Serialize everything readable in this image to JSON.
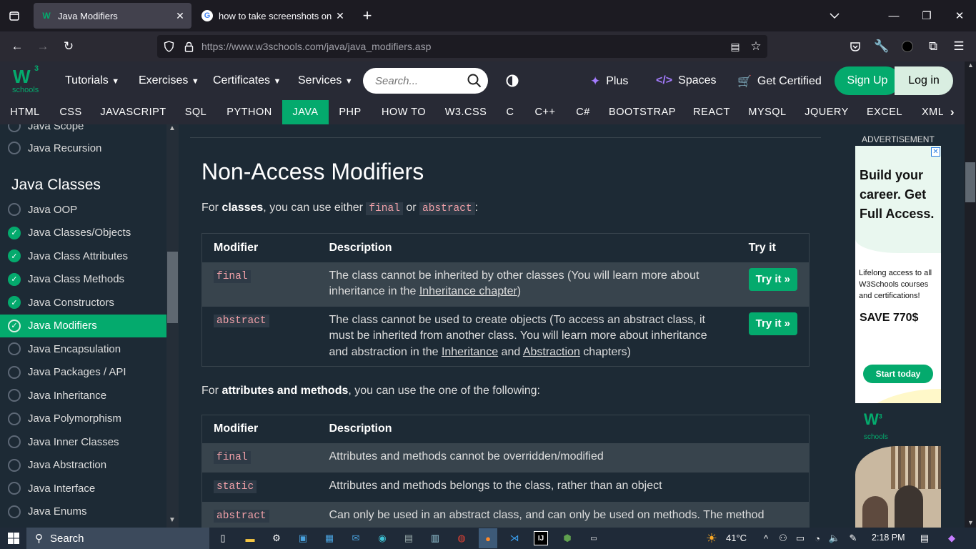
{
  "browser": {
    "tabs": [
      {
        "label": "Java Modifiers",
        "favicon": "w3schools-favicon",
        "active": true
      },
      {
        "label": "how to take screenshots on lapt",
        "favicon": "google-favicon",
        "active": false
      }
    ],
    "url_host": "https://www.w3schools.com",
    "url_path": "/java/java_modifiers.asp"
  },
  "header": {
    "logo_text": "schools",
    "logo_sup": "3",
    "logo_w": "W",
    "menus": [
      "Tutorials",
      "Exercises",
      "Certificates",
      "Services"
    ],
    "search_placeholder": "Search...",
    "plus": "Plus",
    "spaces": "Spaces",
    "get_certified": "Get Certified",
    "sign_up": "Sign Up",
    "log_in": "Log in"
  },
  "topnav": [
    "HTML",
    "CSS",
    "JAVASCRIPT",
    "SQL",
    "PYTHON",
    "JAVA",
    "PHP",
    "HOW TO",
    "W3.CSS",
    "C",
    "C++",
    "C#",
    "BOOTSTRAP",
    "REACT",
    "MYSQL",
    "JQUERY",
    "EXCEL",
    "XML"
  ],
  "sidebar": {
    "items_top": [
      "Java Scope",
      "Java Recursion"
    ],
    "section_title": "Java Classes",
    "items": [
      {
        "label": "Java OOP",
        "done": false
      },
      {
        "label": "Java Classes/Objects",
        "done": true
      },
      {
        "label": "Java Class Attributes",
        "done": true
      },
      {
        "label": "Java Class Methods",
        "done": true
      },
      {
        "label": "Java Constructors",
        "done": true
      },
      {
        "label": "Java Modifiers",
        "done": true,
        "active": true
      },
      {
        "label": "Java Encapsulation",
        "done": false
      },
      {
        "label": "Java Packages / API",
        "done": false
      },
      {
        "label": "Java Inheritance",
        "done": false
      },
      {
        "label": "Java Polymorphism",
        "done": false
      },
      {
        "label": "Java Inner Classes",
        "done": false
      },
      {
        "label": "Java Abstraction",
        "done": false
      },
      {
        "label": "Java Interface",
        "done": false
      },
      {
        "label": "Java Enums",
        "done": false
      }
    ]
  },
  "main": {
    "heading": "Non-Access Modifiers",
    "para1": {
      "pre": "For ",
      "bold": "classes",
      "mid": ", you can use either ",
      "code1": "final",
      "or": " or ",
      "code2": "abstract",
      "post": ":"
    },
    "table1": {
      "headers": [
        "Modifier",
        "Description",
        "Try it"
      ],
      "rows": [
        {
          "modifier": "final",
          "desc_pre": "The class cannot be inherited by other classes (You will learn more about inheritance in the ",
          "link1": "Inheritance chapter",
          "desc_post": ")",
          "try": "Try it »"
        },
        {
          "modifier": "abstract",
          "desc_pre": "The class cannot be used to create objects (To access an abstract class, it must be inherited from another class. You will learn more about inheritance and abstraction in the ",
          "link1": "Inheritance",
          "and": " and ",
          "link2": "Abstraction",
          "desc_post": " chapters)",
          "try": "Try it »"
        }
      ]
    },
    "para2": {
      "pre": "For ",
      "bold": "attributes and methods",
      "post": ", you can use the one of the following:"
    },
    "table2": {
      "headers": [
        "Modifier",
        "Description"
      ],
      "rows": [
        {
          "modifier": "final",
          "desc": "Attributes and methods cannot be overridden/modified"
        },
        {
          "modifier": "static",
          "desc": "Attributes and methods belongs to the class, rather than an object"
        },
        {
          "modifier": "abstract",
          "desc": "Can only be used in an abstract class, and can only be used on methods. The method"
        }
      ]
    }
  },
  "ad": {
    "label": "ADVERTISEMENT",
    "headline": "Build your career. Get Full Access.",
    "body": "Lifelong access to all W3Schools courses and certifications!",
    "save": "SAVE 770$",
    "cta": "Start today",
    "logo_text": "schools",
    "close": "✕"
  },
  "taskbar": {
    "search": "Search",
    "weather": "41°C",
    "time": "2:18 PM"
  },
  "colors": {
    "accent": "#04aa6d",
    "bg": "#1d2a35",
    "header": "#282a35",
    "code": "#f0a0a8"
  }
}
